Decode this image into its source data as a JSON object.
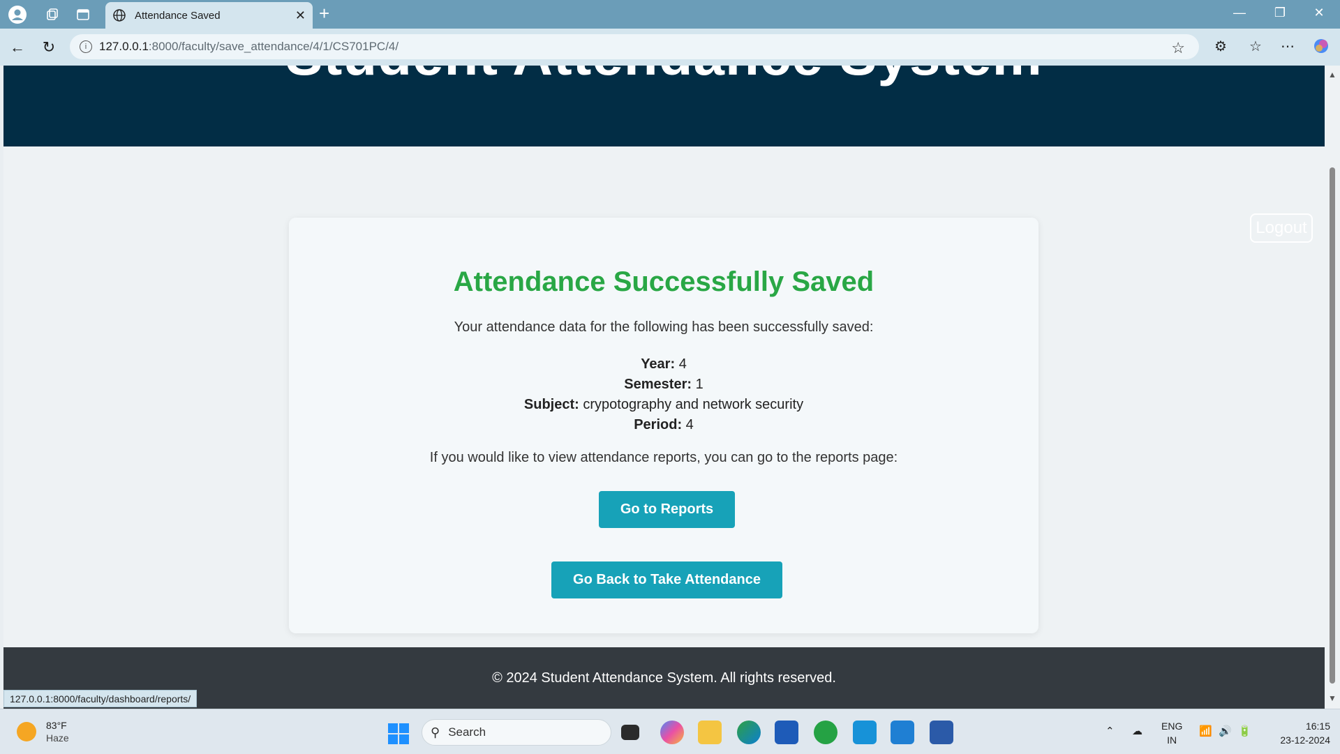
{
  "browser": {
    "tab_title": "Attendance Saved",
    "url_host": "127.0.0.1",
    "url_path": ":8000/faculty/save_attendance/4/1/CS701PC/4/",
    "status_url": "127.0.0.1:8000/faculty/dashboard/reports/"
  },
  "page": {
    "header_title": "Student Attendance System",
    "logout_label": "Logout",
    "heading": "Attendance Successfully Saved",
    "intro": "Your attendance data for the following has been successfully saved:",
    "details": {
      "year_label": "Year:",
      "year_value": "4",
      "semester_label": "Semester:",
      "semester_value": "1",
      "subject_label": "Subject:",
      "subject_value": "crypotography and network security",
      "period_label": "Period:",
      "period_value": "4"
    },
    "reports_text": "If you would like to view attendance reports, you can go to the reports page:",
    "reports_button": "Go to Reports",
    "back_button": "Go Back to Take Attendance",
    "footer": "© 2024 Student Attendance System. All rights reserved."
  },
  "taskbar": {
    "temperature": "83°F",
    "condition": "Haze",
    "search_placeholder": "Search",
    "lang_top": "ENG",
    "lang_bottom": "IN",
    "time": "16:15",
    "date": "23-12-2024"
  },
  "colors": {
    "header_bg": "#022d45",
    "success_green": "#29a745",
    "button_teal": "#17a2b8",
    "footer_bg": "#343a40"
  }
}
